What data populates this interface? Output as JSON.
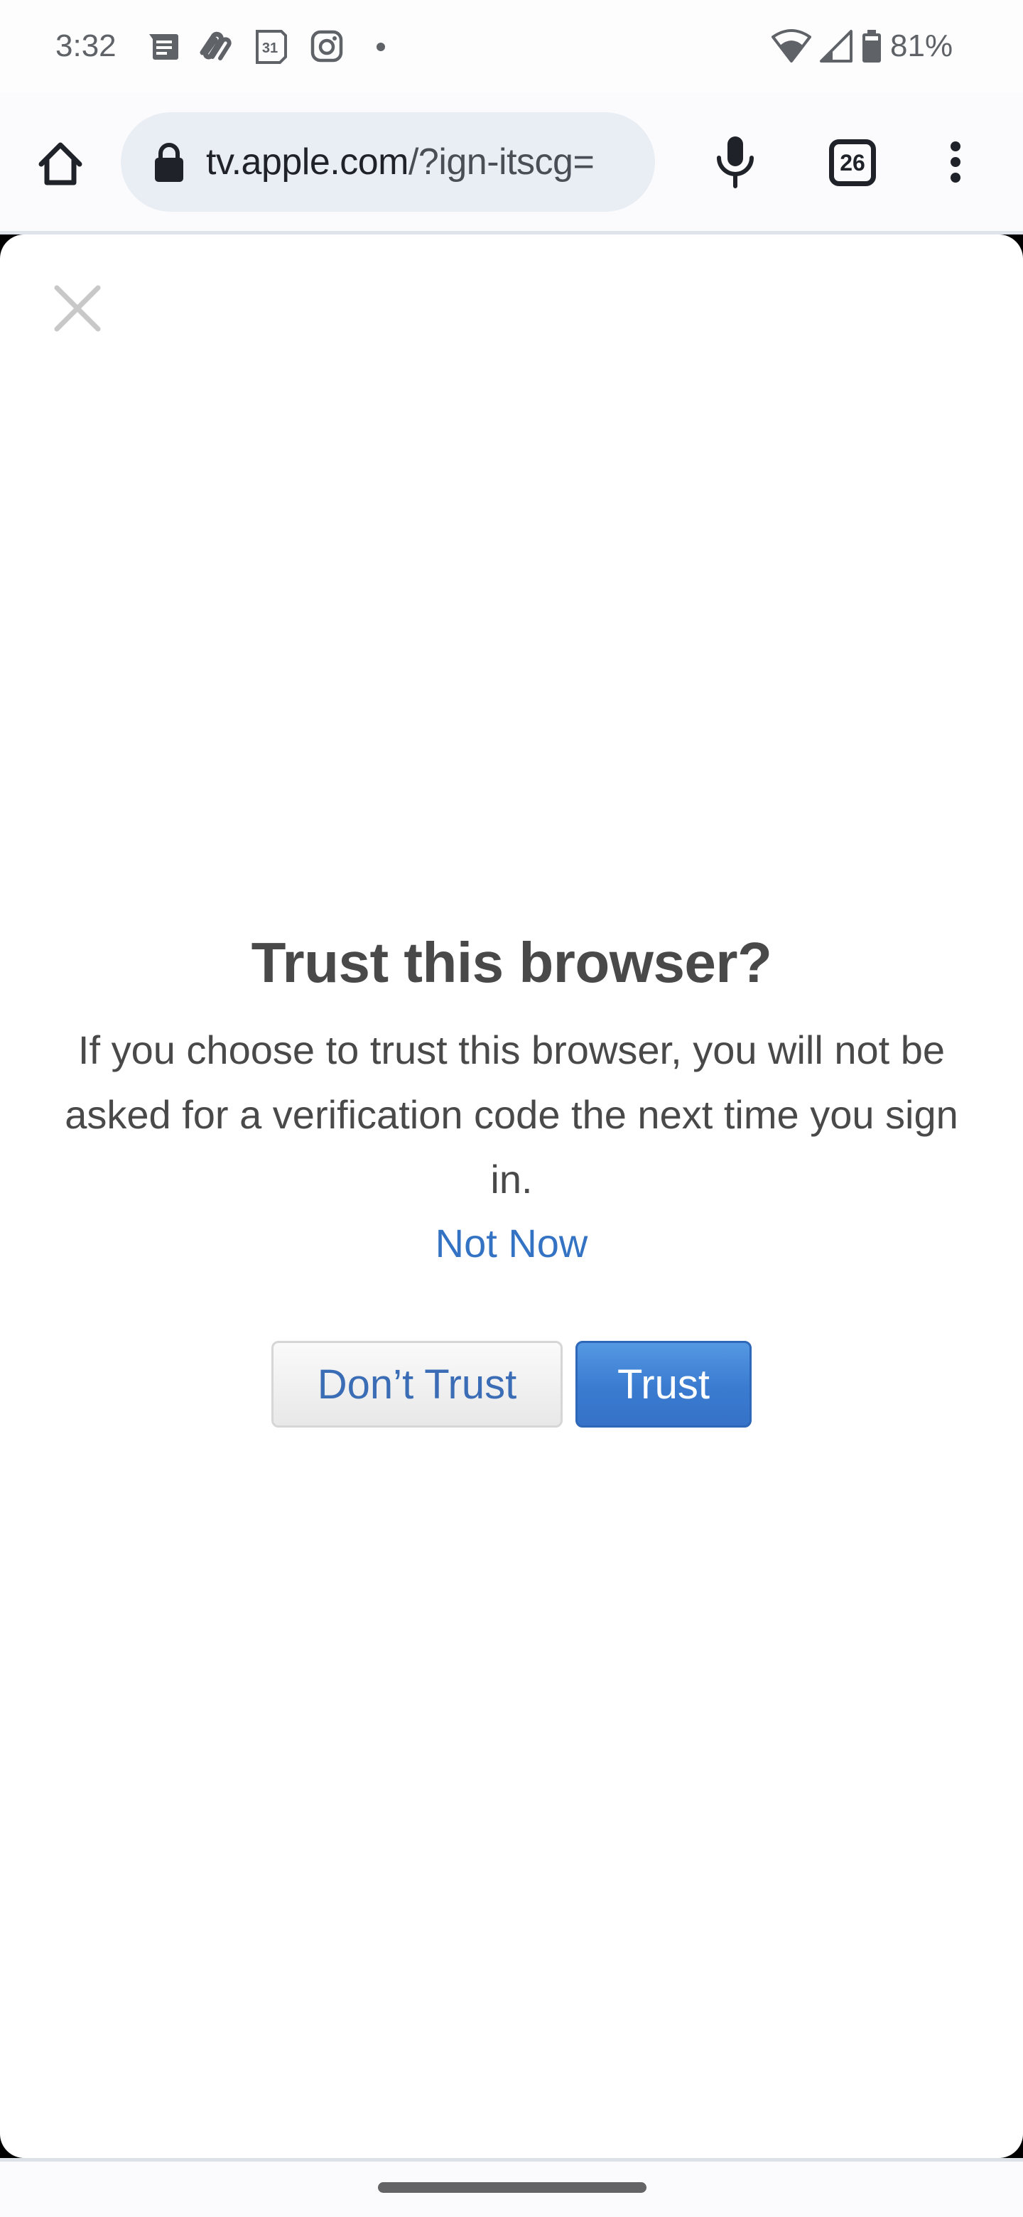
{
  "status_bar": {
    "time": "3:32",
    "notification_icons": [
      "messages-icon",
      "paperclip-app-icon",
      "calendar-31-icon",
      "instagram-icon",
      "more-notifications-dot-icon"
    ],
    "calendar_day": "31",
    "system_icons": [
      "wifi-icon",
      "cell-signal-icon",
      "battery-icon"
    ],
    "battery_percent": "81%"
  },
  "browser": {
    "url_host": "tv.apple.com",
    "url_rest": "/?ign-itscg=",
    "tab_count": "26",
    "icons": {
      "home": "home-icon",
      "lock": "lock-icon",
      "mic": "microphone-icon",
      "tabs": "tab-switcher-icon",
      "menu": "more-vert-icon"
    }
  },
  "dialog": {
    "close_icon": "close-icon",
    "title": "Trust this browser?",
    "body": "If you choose to trust this browser, you will not be asked for a verification code the next time you sign in.",
    "not_now_label": "Not Now",
    "dont_trust_label": "Don’t Trust",
    "trust_label": "Trust"
  },
  "colors": {
    "link_blue": "#3473c3",
    "trust_button": "#3a7bd0",
    "text_gray": "#494949",
    "url_pill": "#e9eef4"
  }
}
